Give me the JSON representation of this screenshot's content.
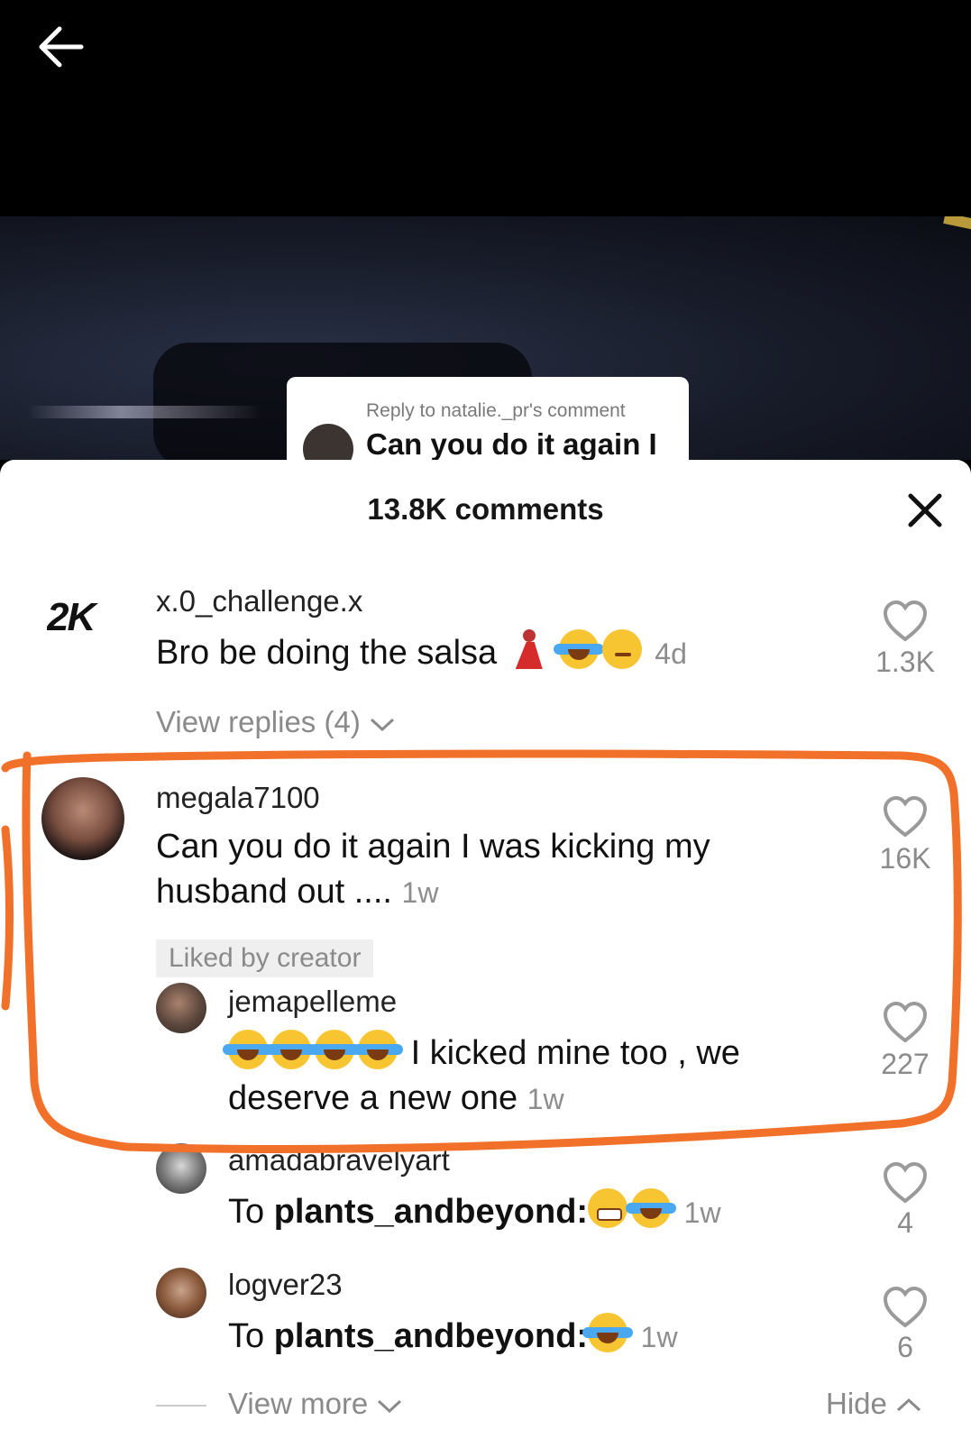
{
  "video": {
    "reply_to": "Reply to natalie._pr's comment",
    "reply_text": "Can you do it again I"
  },
  "sheet": {
    "title": "13.8K comments",
    "view_more": "View more",
    "hide": "Hide"
  },
  "comments": [
    {
      "username": "x.0_challenge.x",
      "avatar_text": "2K",
      "text": "Bro be doing the salsa",
      "time": "4d",
      "likes": "1.3K",
      "view_replies": "View replies (4)"
    },
    {
      "username": "megala7100",
      "text_line1": "Can you do it again I was kicking my",
      "text_line2": "husband out ....",
      "time": "1w",
      "likes": "16K",
      "badge": "Liked by creator"
    }
  ],
  "replies": [
    {
      "username": "jemapelleme",
      "text_line1": "I kicked mine too , we",
      "text_line2": "deserve a new one",
      "time": "1w",
      "likes": "227"
    },
    {
      "username": "amadabravelyart",
      "prefix": "To ",
      "mention": "plants_andbeyond",
      "time": "1w",
      "likes": "4"
    },
    {
      "username": "logver23",
      "prefix": "To ",
      "mention": "plants_andbeyond",
      "time": "1w",
      "likes": "6"
    }
  ],
  "colors": {
    "annotation": "#f2712a",
    "muted": "#8a8a8a"
  }
}
